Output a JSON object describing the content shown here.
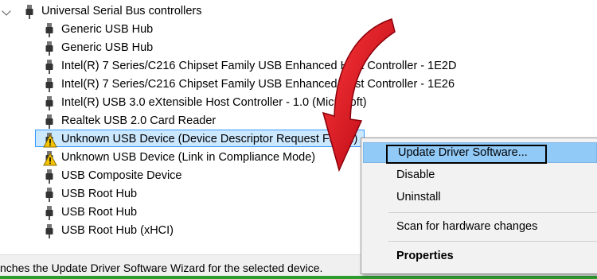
{
  "tree": {
    "category": "Universal Serial Bus controllers",
    "devices": [
      {
        "label": "Generic USB Hub",
        "warning": false
      },
      {
        "label": "Generic USB Hub",
        "warning": false
      },
      {
        "label": "Intel(R) 7 Series/C216 Chipset Family USB Enhanced Host Controller - 1E2D",
        "warning": false
      },
      {
        "label": "Intel(R) 7 Series/C216 Chipset Family USB Enhanced Host Controller - 1E26",
        "warning": false
      },
      {
        "label": "Intel(R) USB 3.0 eXtensible Host Controller - 1.0 (Microsoft)",
        "warning": false
      },
      {
        "label": "Realtek USB 2.0 Card Reader",
        "warning": false
      },
      {
        "label": "Unknown USB Device (Device Descriptor Request Failed)",
        "warning": true,
        "selected": true
      },
      {
        "label": "Unknown USB Device (Link in Compliance Mode)",
        "warning": true
      },
      {
        "label": "USB Composite Device",
        "warning": false
      },
      {
        "label": "USB Root Hub",
        "warning": false
      },
      {
        "label": "USB Root Hub",
        "warning": false
      },
      {
        "label": "USB Root Hub (xHCI)",
        "warning": false
      }
    ]
  },
  "context_menu": {
    "items": [
      {
        "label": "Update Driver Software...",
        "highlighted": true
      },
      {
        "label": "Disable"
      },
      {
        "label": "Uninstall"
      },
      {
        "label": "Scan for hardware changes"
      },
      {
        "label": "Properties",
        "bold": true
      }
    ]
  },
  "status_bar": {
    "text": "nches the Update Driver Software Wizard for the selected device."
  },
  "colors": {
    "selection": "#cce8ff",
    "menu_highlight": "#91c9f7",
    "arrow": "#d9141b",
    "status_green": "#2e9c2e",
    "warning": "#f5c400"
  }
}
